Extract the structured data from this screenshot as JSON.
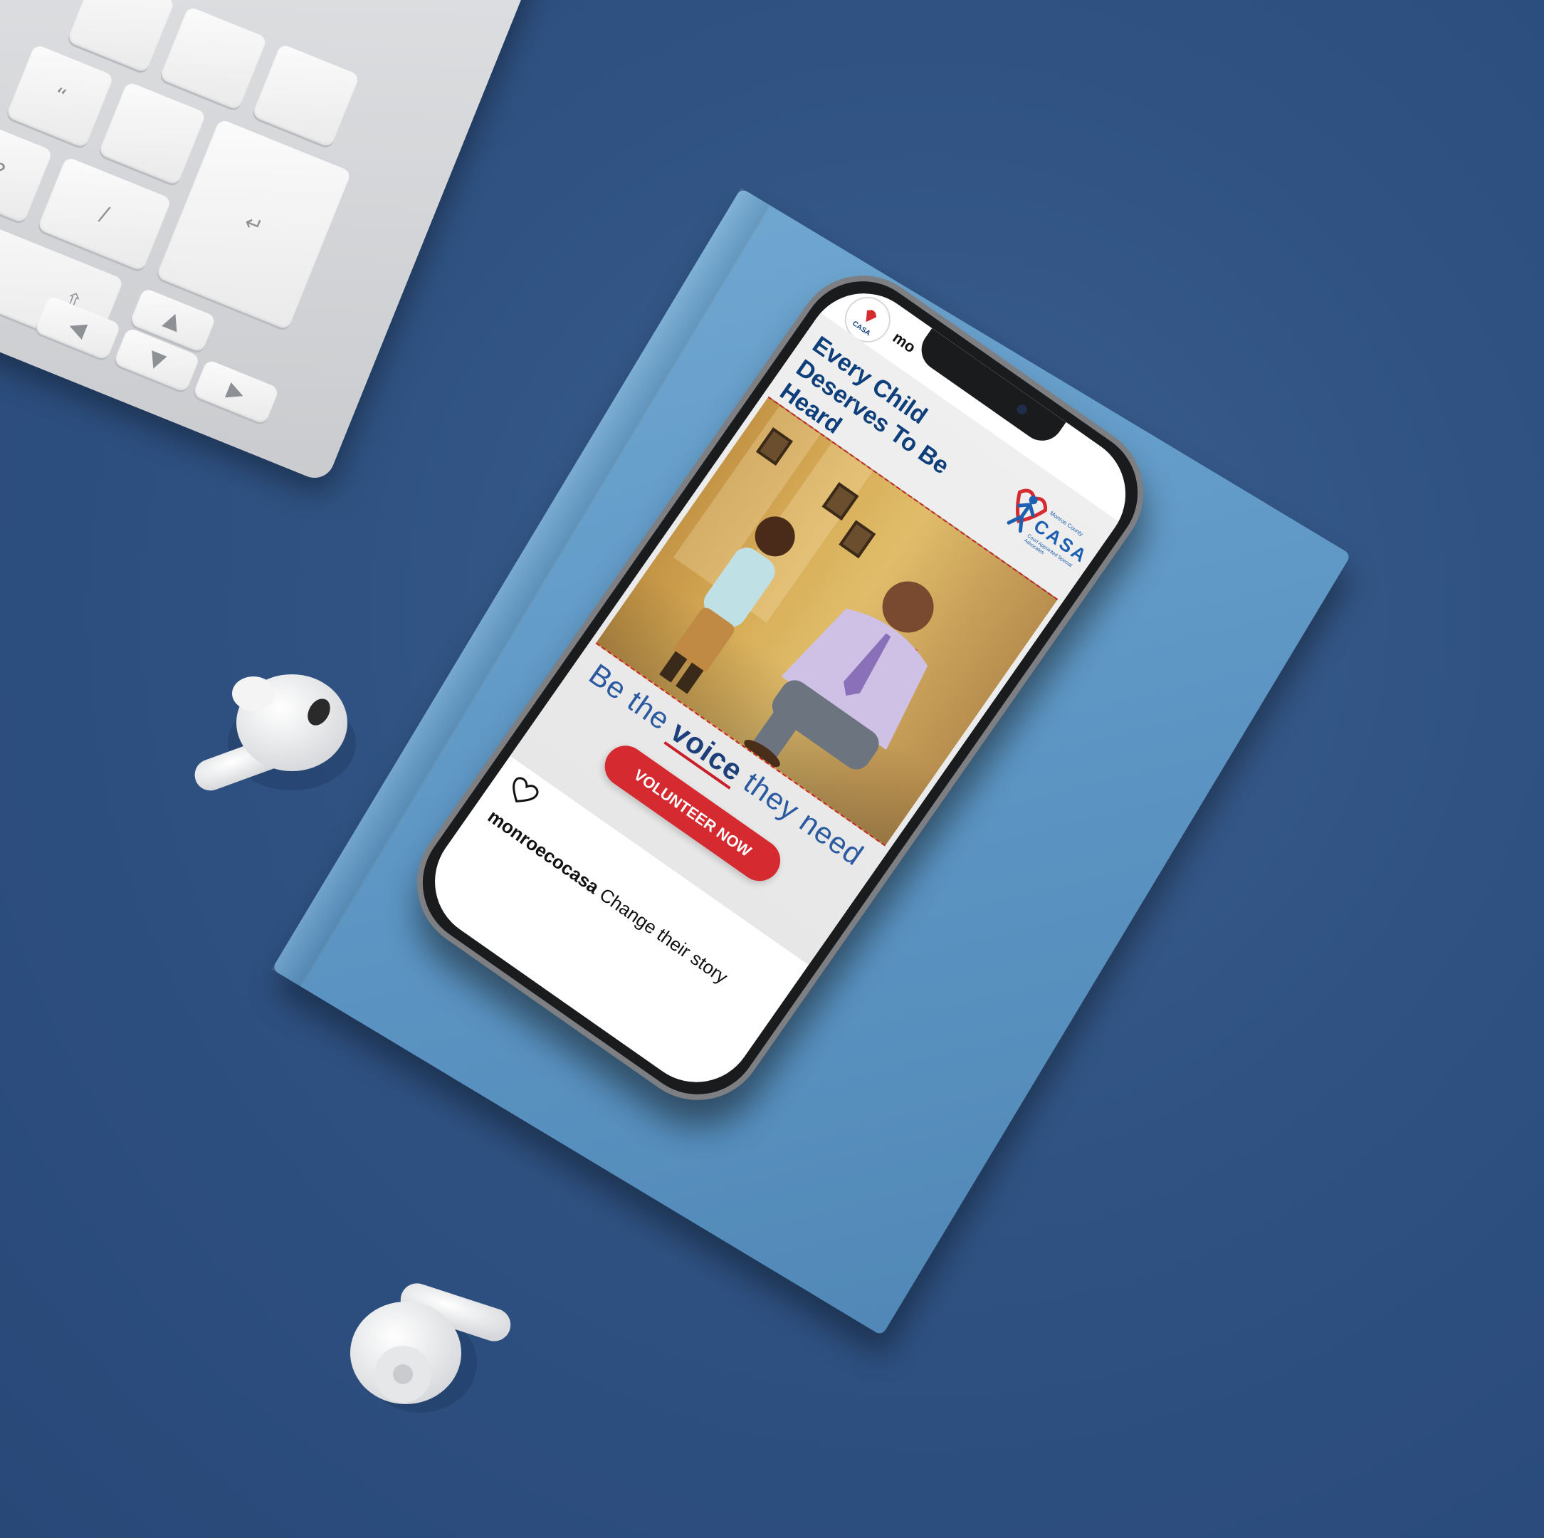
{
  "post": {
    "username": "monroecocasa",
    "username_top_partial": "mo",
    "headline_line1": "Every Child",
    "headline_line2": "Deserves To Be Heard",
    "tagline_pre": "Be the",
    "tagline_voice": "voice",
    "tagline_post": "they need",
    "cta_label": "VOLUNTEER NOW",
    "caption_text": "Change their story"
  },
  "logo": {
    "top_text": "Monroe County",
    "name": "CASA",
    "sub_text": "Court Appointed Special Advocates"
  },
  "icons": {
    "heart": "heart-icon",
    "avatar": "casa-avatar"
  },
  "colors": {
    "background": "#2f5282",
    "notebook": "#5c95c3",
    "headline": "#0f3f7a",
    "accent_red": "#d42a30",
    "tagline": "#2b5aa0"
  },
  "keyboard": {
    "keys": [
      "“",
      "?",
      "/"
    ]
  }
}
